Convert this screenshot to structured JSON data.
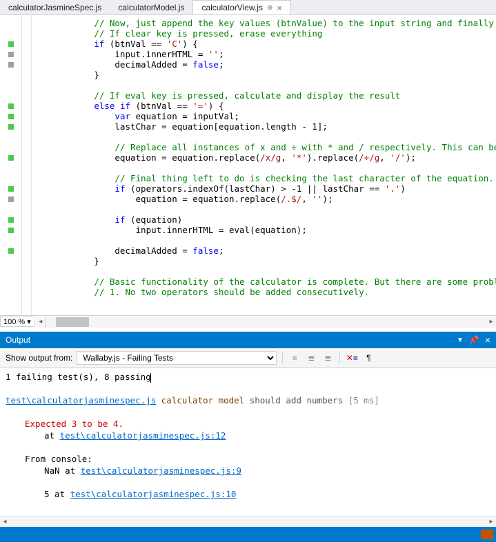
{
  "tabs": [
    {
      "label": "calculatorJasmineSpec.js",
      "active": false,
      "pinned": false
    },
    {
      "label": "calculatorModel.js",
      "active": false,
      "pinned": false
    },
    {
      "label": "calculatorView.js",
      "active": true,
      "pinned": true
    }
  ],
  "zoom": "100 %",
  "code": {
    "lines": [
      {
        "indent": "            ",
        "segments": [
          {
            "t": "// Now, just append the key values (btnValue) to the input string and finally u",
            "c": "cmt"
          }
        ],
        "marker": ""
      },
      {
        "indent": "            ",
        "segments": [
          {
            "t": "// If clear key is pressed, erase everything",
            "c": "cmt"
          }
        ],
        "marker": ""
      },
      {
        "indent": "            ",
        "segments": [
          {
            "t": "if",
            "c": "kw"
          },
          {
            "t": " (btnVal == "
          },
          {
            "t": "'C'",
            "c": "str"
          },
          {
            "t": ") {"
          }
        ],
        "marker": "green"
      },
      {
        "indent": "                ",
        "segments": [
          {
            "t": "input.innerHTML = "
          },
          {
            "t": "''",
            "c": "str"
          },
          {
            "t": ";"
          }
        ],
        "marker": "gray"
      },
      {
        "indent": "                ",
        "segments": [
          {
            "t": "decimalAdded = "
          },
          {
            "t": "false",
            "c": "kw"
          },
          {
            "t": ";"
          }
        ],
        "marker": "gray"
      },
      {
        "indent": "            ",
        "segments": [
          {
            "t": "}"
          }
        ],
        "marker": ""
      },
      {
        "indent": "",
        "segments": [
          {
            "t": ""
          }
        ],
        "marker": ""
      },
      {
        "indent": "            ",
        "segments": [
          {
            "t": "// If eval key is pressed, calculate and display the result",
            "c": "cmt"
          }
        ],
        "marker": ""
      },
      {
        "indent": "            ",
        "segments": [
          {
            "t": "else",
            "c": "kw"
          },
          {
            "t": " "
          },
          {
            "t": "if",
            "c": "kw"
          },
          {
            "t": " (btnVal == "
          },
          {
            "t": "'='",
            "c": "str"
          },
          {
            "t": ") {"
          }
        ],
        "marker": "green"
      },
      {
        "indent": "                ",
        "segments": [
          {
            "t": "var",
            "c": "kw"
          },
          {
            "t": " equation = inputVal;"
          }
        ],
        "marker": "green"
      },
      {
        "indent": "                ",
        "segments": [
          {
            "t": "lastChar = equation[equation.length - 1];"
          }
        ],
        "marker": "green"
      },
      {
        "indent": "",
        "segments": [
          {
            "t": ""
          }
        ],
        "marker": ""
      },
      {
        "indent": "                ",
        "segments": [
          {
            "t": "// Replace all instances of x and ÷ with * and / respectively. This can be",
            "c": "cmt"
          }
        ],
        "marker": ""
      },
      {
        "indent": "                ",
        "segments": [
          {
            "t": "equation = equation.replace("
          },
          {
            "t": "/x/g",
            "c": "re"
          },
          {
            "t": ", "
          },
          {
            "t": "'*'",
            "c": "str"
          },
          {
            "t": ").replace("
          },
          {
            "t": "/÷/g",
            "c": "re"
          },
          {
            "t": ", "
          },
          {
            "t": "'/'",
            "c": "str"
          },
          {
            "t": ");"
          }
        ],
        "marker": "green"
      },
      {
        "indent": "",
        "segments": [
          {
            "t": ""
          }
        ],
        "marker": ""
      },
      {
        "indent": "                ",
        "segments": [
          {
            "t": "// Final thing left to do is checking the last character of the equation. ",
            "c": "cmt"
          }
        ],
        "marker": ""
      },
      {
        "indent": "                ",
        "segments": [
          {
            "t": "if",
            "c": "kw"
          },
          {
            "t": " (operators.indexOf(lastChar) > -1 || lastChar == "
          },
          {
            "t": "'.'",
            "c": "str"
          },
          {
            "t": ")"
          }
        ],
        "marker": "green"
      },
      {
        "indent": "                    ",
        "segments": [
          {
            "t": "equation = equation.replace("
          },
          {
            "t": "/.$/",
            "c": "re"
          },
          {
            "t": ", "
          },
          {
            "t": "''",
            "c": "str"
          },
          {
            "t": ");"
          }
        ],
        "marker": "gray"
      },
      {
        "indent": "",
        "segments": [
          {
            "t": ""
          }
        ],
        "marker": ""
      },
      {
        "indent": "                ",
        "segments": [
          {
            "t": "if",
            "c": "kw"
          },
          {
            "t": " (equation)"
          }
        ],
        "marker": "green"
      },
      {
        "indent": "                    ",
        "segments": [
          {
            "t": "input.innerHTML = eval(equation);"
          }
        ],
        "marker": "green"
      },
      {
        "indent": "",
        "segments": [
          {
            "t": ""
          }
        ],
        "marker": ""
      },
      {
        "indent": "                ",
        "segments": [
          {
            "t": "decimalAdded = "
          },
          {
            "t": "false",
            "c": "kw"
          },
          {
            "t": ";"
          }
        ],
        "marker": "green"
      },
      {
        "indent": "            ",
        "segments": [
          {
            "t": "}"
          }
        ],
        "marker": ""
      },
      {
        "indent": "",
        "segments": [
          {
            "t": ""
          }
        ],
        "marker": ""
      },
      {
        "indent": "            ",
        "segments": [
          {
            "t": "// Basic functionality of the calculator is complete. But there are some probl",
            "c": "cmt"
          }
        ],
        "marker": ""
      },
      {
        "indent": "            ",
        "segments": [
          {
            "t": "// 1. No two operators should be added consecutively.",
            "c": "cmt"
          }
        ],
        "marker": ""
      }
    ]
  },
  "output": {
    "title": "Output",
    "source_label": "Show output from:",
    "source_value": "Wallaby.js - Failing Tests",
    "summary": "1 failing test(s), 8 passing",
    "file_link": "test\\calculatorjasminespec.js",
    "spec_name": "calculator model",
    "spec_should": "should add numbers",
    "spec_time": "[5 ms]",
    "expect_msg": "Expected 3 to be 4.",
    "expect_at": "at ",
    "expect_at_link": "test\\calculatorjasminespec.js:12",
    "console_label": "From console:",
    "console_entries": [
      {
        "prefix": "NaN at ",
        "link": "test\\calculatorjasminespec.js:9"
      },
      {
        "prefix": "5 at ",
        "link": "test\\calculatorjasminespec.js:10"
      }
    ]
  }
}
